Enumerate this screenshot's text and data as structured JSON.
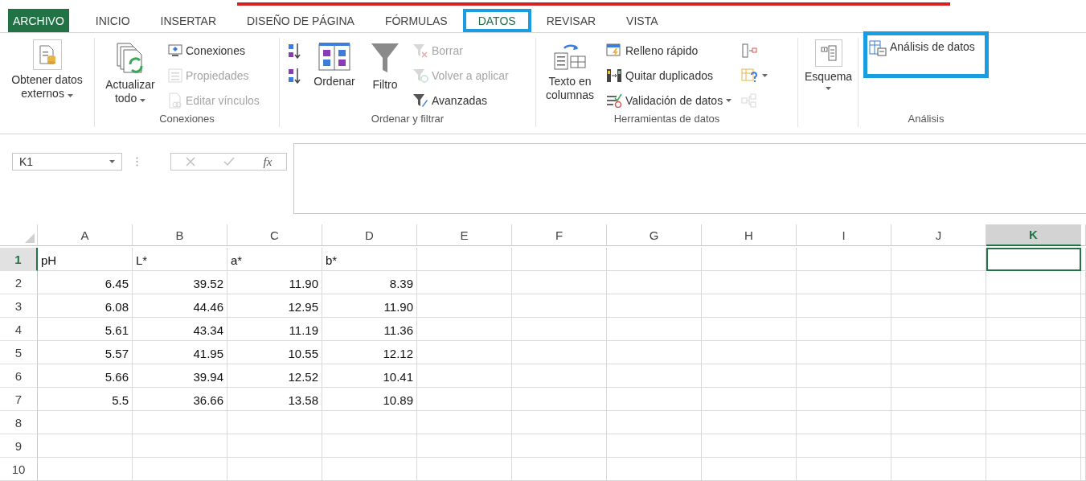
{
  "tabs": [
    {
      "label": "ARCHIVO",
      "kind": "file",
      "selected": false,
      "highlighted": false
    },
    {
      "label": "INICIO",
      "kind": "tab",
      "selected": false,
      "highlighted": false
    },
    {
      "label": "INSERTAR",
      "kind": "tab",
      "selected": false,
      "highlighted": false
    },
    {
      "label": "DISEÑO DE PÁGINA",
      "kind": "tab",
      "selected": false,
      "highlighted": false
    },
    {
      "label": "FÓRMULAS",
      "kind": "tab",
      "selected": false,
      "highlighted": false
    },
    {
      "label": "DATOS",
      "kind": "tab",
      "selected": true,
      "highlighted": true
    },
    {
      "label": "REVISAR",
      "kind": "tab",
      "selected": false,
      "highlighted": false
    },
    {
      "label": "VISTA",
      "kind": "tab",
      "selected": false,
      "highlighted": false
    }
  ],
  "ribbon": {
    "groups": [
      {
        "buttons": [
          {
            "kind": "large",
            "label": "Obtener datos externos",
            "disabled": false,
            "dropdown": true,
            "highlighted": false
          }
        ]
      },
      {
        "label": "Conexiones",
        "buttons": [
          {
            "kind": "large",
            "label": "Actualizar todo",
            "disabled": false,
            "dropdown": true,
            "highlighted": false
          },
          {
            "kind": "small",
            "label": "Conexiones",
            "disabled": false,
            "dropdown": false,
            "highlighted": false
          },
          {
            "kind": "small",
            "label": "Propiedades",
            "disabled": true,
            "dropdown": false,
            "highlighted": false
          },
          {
            "kind": "small",
            "label": "Editar vínculos",
            "disabled": true,
            "dropdown": false,
            "highlighted": false
          }
        ]
      },
      {
        "label": "Ordenar y filtrar",
        "buttons": [
          {
            "kind": "icon",
            "disabled": false,
            "dropdown": false,
            "highlighted": false
          },
          {
            "kind": "icon",
            "disabled": false,
            "dropdown": false,
            "highlighted": false
          },
          {
            "kind": "large",
            "label": "Ordenar",
            "disabled": false,
            "dropdown": false,
            "highlighted": false
          },
          {
            "kind": "large",
            "label": "Filtro",
            "disabled": false,
            "dropdown": false,
            "highlighted": false
          },
          {
            "kind": "small",
            "label": "Borrar",
            "disabled": true,
            "dropdown": false,
            "highlighted": false
          },
          {
            "kind": "small",
            "label": "Volver a aplicar",
            "disabled": true,
            "dropdown": false,
            "highlighted": false
          },
          {
            "kind": "small",
            "label": "Avanzadas",
            "disabled": false,
            "dropdown": false,
            "highlighted": false
          }
        ]
      },
      {
        "label": "Herramientas de datos",
        "buttons": [
          {
            "kind": "large",
            "label": "Texto en columnas",
            "disabled": false,
            "dropdown": false,
            "highlighted": false
          },
          {
            "kind": "small",
            "label": "Relleno rápido",
            "disabled": false,
            "dropdown": false,
            "highlighted": false
          },
          {
            "kind": "small",
            "label": "Quitar duplicados",
            "disabled": false,
            "dropdown": false,
            "highlighted": false
          },
          {
            "kind": "small",
            "label": "Validación de datos",
            "disabled": false,
            "dropdown": true,
            "highlighted": false
          },
          {
            "kind": "icon",
            "disabled": false,
            "dropdown": false,
            "highlighted": false
          },
          {
            "kind": "icon",
            "disabled": false,
            "dropdown": true,
            "highlighted": false
          },
          {
            "kind": "icon",
            "disabled": true,
            "dropdown": false,
            "highlighted": false
          }
        ]
      },
      {
        "buttons": [
          {
            "kind": "large",
            "label": "Esquema",
            "disabled": false,
            "dropdown": true,
            "highlighted": false
          }
        ]
      },
      {
        "label": "Análisis",
        "buttons": [
          {
            "kind": "small",
            "label": "Análisis de datos",
            "disabled": false,
            "dropdown": false,
            "highlighted": true
          }
        ]
      }
    ]
  },
  "formula_bar": {
    "name_box": "K1",
    "function_label": "fx"
  },
  "sheet": {
    "columns": [
      {
        "label": "A",
        "selected": false
      },
      {
        "label": "B",
        "selected": false
      },
      {
        "label": "C",
        "selected": false
      },
      {
        "label": "D",
        "selected": false
      },
      {
        "label": "E",
        "selected": false
      },
      {
        "label": "F",
        "selected": false
      },
      {
        "label": "G",
        "selected": false
      },
      {
        "label": "H",
        "selected": false
      },
      {
        "label": "I",
        "selected": false
      },
      {
        "label": "J",
        "selected": false
      },
      {
        "label": "K",
        "selected": true
      }
    ],
    "rows": [
      {
        "header": "1",
        "selected": true,
        "cells": [
          {
            "text": "pH",
            "kind": "text"
          },
          {
            "text": "L*",
            "kind": "text"
          },
          {
            "text": "a*",
            "kind": "text"
          },
          {
            "text": "b*",
            "kind": "text"
          }
        ]
      },
      {
        "header": "2",
        "selected": false,
        "cells": [
          {
            "text": "6.45",
            "kind": "number"
          },
          {
            "text": "39.52",
            "kind": "number"
          },
          {
            "text": "11.90",
            "kind": "number"
          },
          {
            "text": "8.39",
            "kind": "number"
          }
        ]
      },
      {
        "header": "3",
        "selected": false,
        "cells": [
          {
            "text": "6.08",
            "kind": "number"
          },
          {
            "text": "44.46",
            "kind": "number"
          },
          {
            "text": "12.95",
            "kind": "number"
          },
          {
            "text": "11.90",
            "kind": "number"
          }
        ]
      },
      {
        "header": "4",
        "selected": false,
        "cells": [
          {
            "text": "5.61",
            "kind": "number"
          },
          {
            "text": "43.34",
            "kind": "number"
          },
          {
            "text": "11.19",
            "kind": "number"
          },
          {
            "text": "11.36",
            "kind": "number"
          }
        ]
      },
      {
        "header": "5",
        "selected": false,
        "cells": [
          {
            "text": "5.57",
            "kind": "number"
          },
          {
            "text": "41.95",
            "kind": "number"
          },
          {
            "text": "10.55",
            "kind": "number"
          },
          {
            "text": "12.12",
            "kind": "number"
          }
        ]
      },
      {
        "header": "6",
        "selected": false,
        "cells": [
          {
            "text": "5.66",
            "kind": "number"
          },
          {
            "text": "39.94",
            "kind": "number"
          },
          {
            "text": "12.52",
            "kind": "number"
          },
          {
            "text": "10.41",
            "kind": "number"
          }
        ]
      },
      {
        "header": "7",
        "selected": false,
        "cells": [
          {
            "text": "5.5",
            "kind": "number"
          },
          {
            "text": "36.66",
            "kind": "number"
          },
          {
            "text": "13.58",
            "kind": "number"
          },
          {
            "text": "10.89",
            "kind": "number"
          }
        ]
      },
      {
        "header": "8",
        "selected": false
      },
      {
        "header": "9",
        "selected": false
      },
      {
        "header": "10",
        "selected": false
      }
    ]
  }
}
